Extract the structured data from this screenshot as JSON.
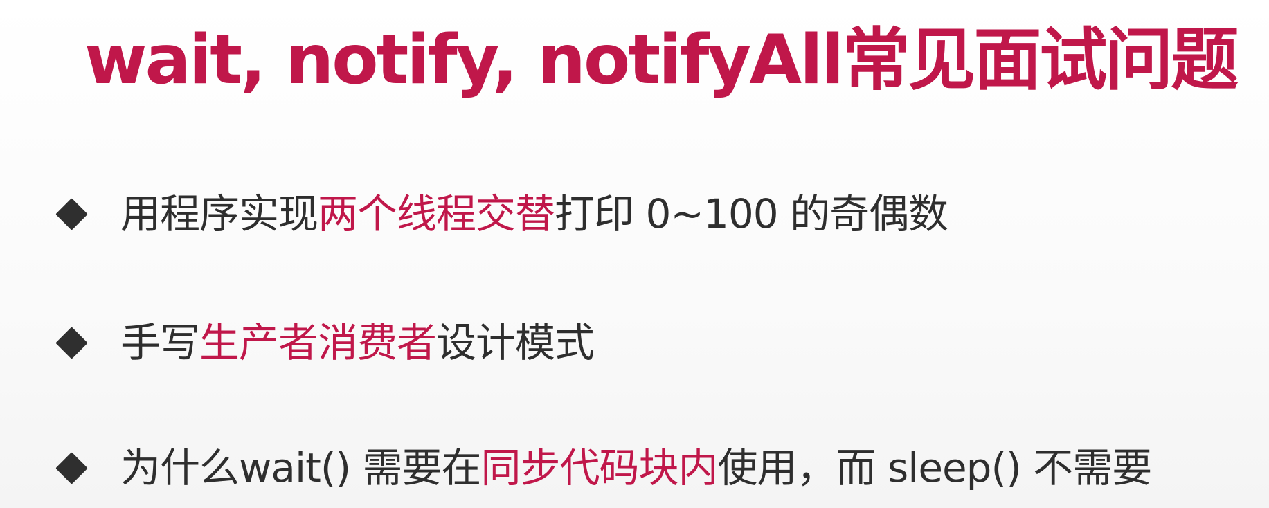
{
  "colors": {
    "accent": "#c0174a",
    "text": "#2e2e2e",
    "bullet": "#2f2f2f",
    "background": "#ffffff"
  },
  "title": "wait, notify, notifyAll常见面试问题",
  "bullet_icon": "diamond-bullet",
  "questions": [
    {
      "before": "用程序实现",
      "highlight": "两个线程交替",
      "after": "打印 0~100 的奇偶数"
    },
    {
      "before": "手写",
      "highlight": "生产者消费者",
      "after": "设计模式"
    },
    {
      "before": "为什么wait() 需要在",
      "highlight": "同步代码块内",
      "after": "使用，而 sleep() 不需要"
    }
  ]
}
